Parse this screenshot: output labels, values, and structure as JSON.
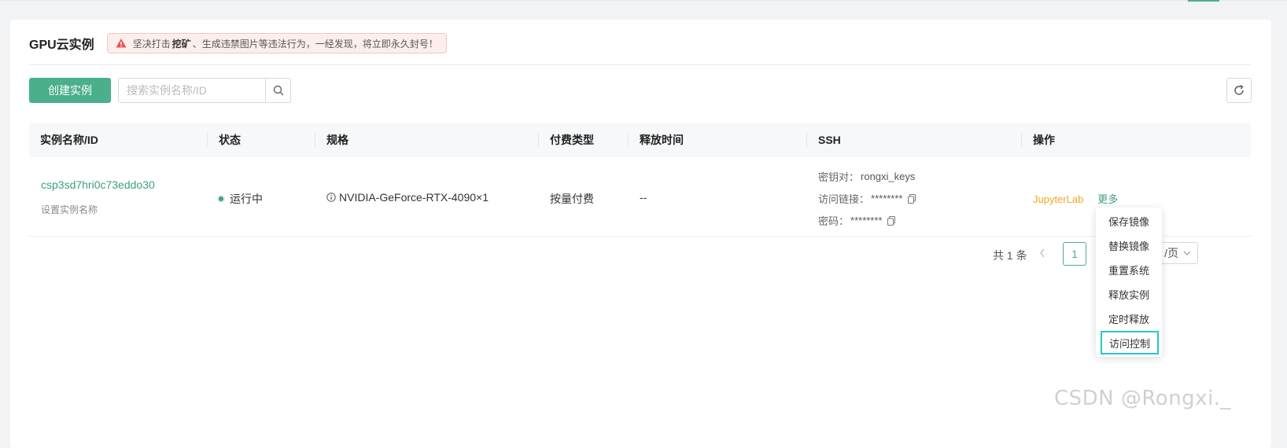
{
  "header": {
    "title": "GPU云实例",
    "notice_prefix": "坚决打击",
    "notice_bold": "挖矿",
    "notice_suffix": "、生成违禁图片等违法行为，一经发现，将立即永久封号！"
  },
  "toolbar": {
    "create_label": "创建实例",
    "search_placeholder": "搜索实例名称/ID"
  },
  "table": {
    "columns": [
      "实例名称/ID",
      "状态",
      "规格",
      "付费类型",
      "释放时间",
      "SSH",
      "操作"
    ],
    "rows": [
      {
        "id": "csp3sd7hri0c73eddo30",
        "name_hint": "设置实例名称",
        "status": "运行中",
        "spec": "NVIDIA-GeForce-RTX-4090×1",
        "billing": "按量付费",
        "release_time": "--",
        "ssh": {
          "keypair_label": "密钥对：",
          "keypair_value": "rongxi_keys",
          "link_label": "访问链接：",
          "link_value": "********",
          "password_label": "密码：",
          "password_value": "********"
        },
        "ops": {
          "jupyter": "JupyterLab",
          "more": "更多"
        }
      }
    ]
  },
  "pagination": {
    "total": "共 1 条",
    "current_page": "1",
    "page_size_suffix": "/页"
  },
  "more_menu": {
    "items": [
      "保存镜像",
      "替换镜像",
      "重置系统",
      "释放实例",
      "定时释放",
      "访问控制"
    ],
    "highlighted": "访问控制"
  },
  "watermark": "CSDN @Rongxi._",
  "colors": {
    "brand": "#4caf8c",
    "link_green": "#3ea07a",
    "link_orange": "#f5a623",
    "highlight": "#27c7cf",
    "warning": "#e45656"
  }
}
